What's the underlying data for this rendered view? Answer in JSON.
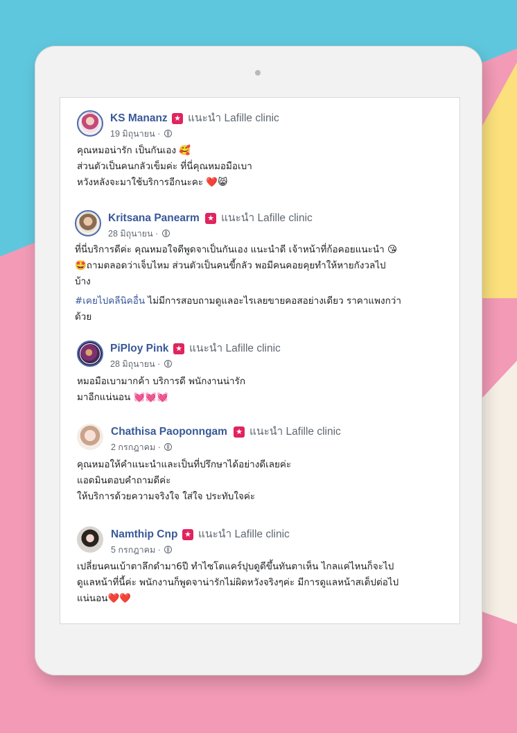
{
  "recommend_label": "แนะนำ Lafille clinic",
  "reviews": [
    {
      "name": "KS Mananz",
      "date": "19 มิถุนายน",
      "lines": [
        "คุณหมอน่ารัก เป็นกันเอง 🥰",
        "ส่วนตัวเป็นคนกลัวเข็มค่ะ ที่นี่คุณหมอมือเบา",
        "หวังหลังจะมาใช้บริการอีกนะคะ ❤️😸"
      ]
    },
    {
      "name": "Kritsana Panearm",
      "date": "28 มิถุนายน",
      "lines": [
        "ที่นี่บริการดีค่ะ คุณหมอใจดีพูดจาเป็นกันเอง แนะนำดี เจ้าหน้าที่ก้อคอยแนะนำ 😘",
        "🤩ถามตลอดว่าเจ็บไหม ส่วนตัวเป็นคนขี้กลัว พอมีคนคอยคุยทำให้หายกังวลไป",
        "บ้าง"
      ],
      "hashtag": "#เคยไปคลีนิคอื่น",
      "tag_rest": " ไม่มีการสอบถามดูแลอะไรเลยขายคอสอย่างเดียว ราคาแพงกว่า",
      "tag_line2": "ด้วย"
    },
    {
      "name": "PiPloy Pink",
      "date": "28 มิถุนายน",
      "lines": [
        "หมอมือเบามากค้า บริการดี พนักงานน่ารัก",
        "มาอีกแน่นอน 💓💓💓"
      ]
    },
    {
      "name": "Chathisa Paoponngam",
      "date": "2 กรกฎาคม",
      "lines": [
        "คุณหมอให้คำแนะนำและเป็นที่ปรึกษาได้อย่างดีเลยค่ะ",
        "แอดมินตอบคำถามดีค่ะ",
        "ให้บริการด้วยความจริงใจ ใส่ใจ ประทับใจค่ะ"
      ]
    },
    {
      "name": "Namthip Cnp",
      "date": "5 กรกฎาคม",
      "lines": [
        "เปลี่ยนคนเบ้าตาลึกดำมา6ปี ทำไซโตแคร์ปุบดูดีขึ้นทันตาเห็น ไกลแค่ไหนก็จะไป",
        "ดูแลหน้าที่นี้ค่ะ พนักงานก็พูดจาน่ารักไม่ผิดหวังจริงๆค่ะ มีการดูแลหน้าสเต็ปต่อไป",
        "แน่นอน❤️❤️"
      ]
    }
  ],
  "icons": {
    "recommend": "recommend-star-icon",
    "privacy": "globe-icon",
    "separator": "·"
  },
  "colors": {
    "name": "#385898",
    "meta": "#606770",
    "recommend_badge": "#e0245e",
    "text": "#1c1e21"
  }
}
